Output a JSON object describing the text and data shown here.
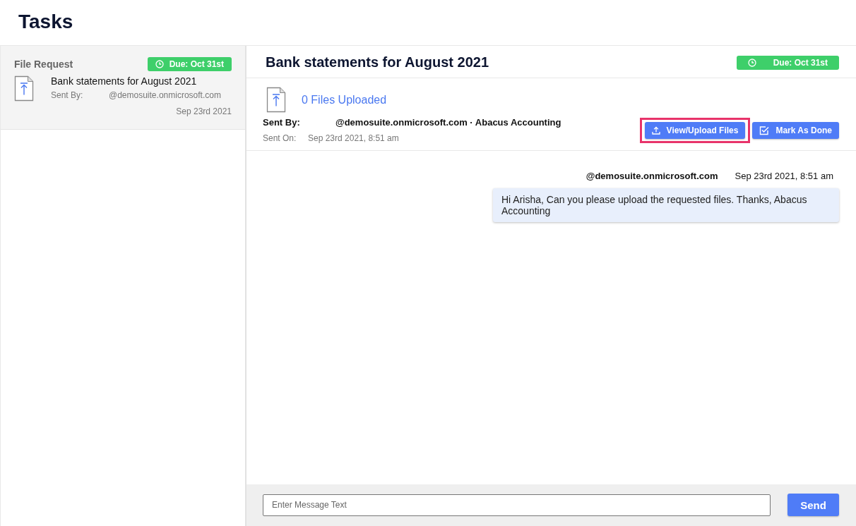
{
  "page": {
    "title": "Tasks"
  },
  "task_list": [
    {
      "type": "File Request",
      "due": "Due: Oct 31st",
      "title": "Bank statements for August 2021",
      "sent_by_label": "Sent By:",
      "sent_by": "@demosuite.onmicrosoft.com",
      "date": "Sep 23rd 2021",
      "selected": true
    }
  ],
  "detail": {
    "title": "Bank statements for August 2021",
    "due": "Due: Oct 31st",
    "files_uploaded": "0 Files Uploaded",
    "sent_by_label": "Sent By:",
    "sent_by": "@demosuite.onmicrosoft.com · Abacus Accounting",
    "sent_on_label": "Sent On:",
    "sent_on": "Sep 23rd 2021, 8:51 am",
    "buttons": [
      {
        "label": "View/Upload Files",
        "kind": "upload",
        "highlighted": true
      },
      {
        "label": "Mark As Done",
        "kind": "done",
        "highlighted": false
      }
    ]
  },
  "messages": [
    {
      "sender": "@demosuite.onmicrosoft.com",
      "time": "Sep 23rd 2021, 8:51 am",
      "text": "Hi Arisha, Can you please upload the requested files. Thanks, Abacus Accounting"
    }
  ],
  "composer": {
    "placeholder": "Enter Message Text",
    "send": "Send"
  }
}
